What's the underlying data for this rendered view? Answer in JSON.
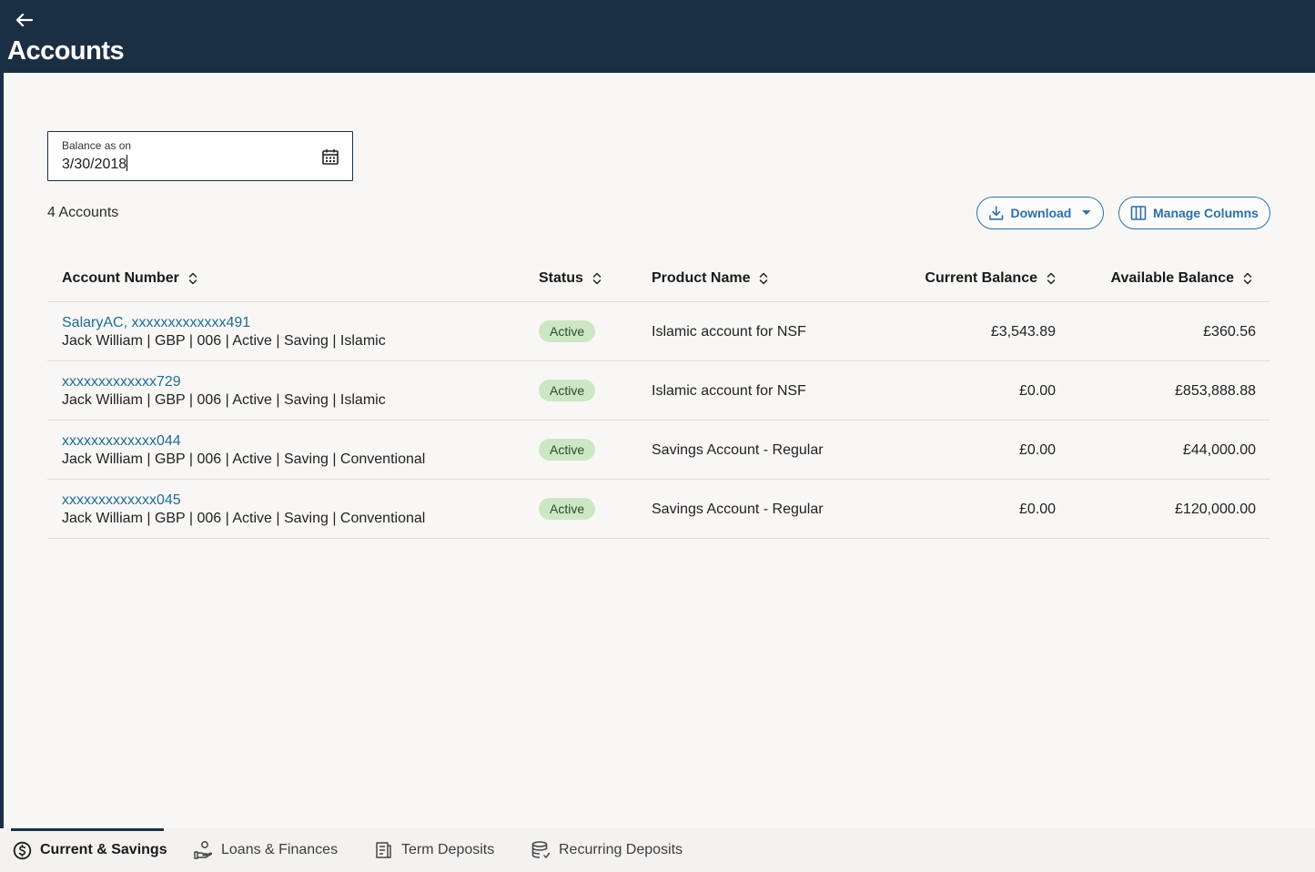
{
  "header": {
    "title": "Accounts",
    "back_icon": "arrow-left-icon"
  },
  "filter": {
    "label": "Balance as on",
    "value": "3/30/2018",
    "icon": "calendar-icon"
  },
  "summary": {
    "count_label": "4 Accounts"
  },
  "toolbar": {
    "download_label": "Download",
    "manage_columns_label": "Manage Columns"
  },
  "table": {
    "columns": [
      "Account Number",
      "Status",
      "Product Name",
      "Current Balance",
      "Available Balance"
    ],
    "rows": [
      {
        "account": "SalaryAC, xxxxxxxxxxxxx491",
        "details": "Jack William | GBP | 006 | Active | Saving | Islamic",
        "status": "Active",
        "product": "Islamic account for NSF",
        "current_balance": "£3,543.89",
        "available_balance": "£360.56"
      },
      {
        "account": "xxxxxxxxxxxxx729",
        "details": "Jack William | GBP | 006 | Active | Saving | Islamic",
        "status": "Active",
        "product": "Islamic account for NSF",
        "current_balance": "£0.00",
        "available_balance": "£853,888.88"
      },
      {
        "account": "xxxxxxxxxxxxx044",
        "details": "Jack William | GBP | 006 | Active | Saving | Conventional",
        "status": "Active",
        "product": "Savings Account - Regular",
        "current_balance": "£0.00",
        "available_balance": "£44,000.00"
      },
      {
        "account": "xxxxxxxxxxxxx045",
        "details": "Jack William | GBP | 006 | Active | Saving | Conventional",
        "status": "Active",
        "product": "Savings Account - Regular",
        "current_balance": "£0.00",
        "available_balance": "£120,000.00"
      }
    ]
  },
  "tabs": [
    {
      "label": "Current & Savings",
      "icon": "dollar-circle-icon",
      "active": true
    },
    {
      "label": "Loans & Finances",
      "icon": "loan-hand-icon",
      "active": false
    },
    {
      "label": "Term Deposits",
      "icon": "term-deposit-icon",
      "active": false
    },
    {
      "label": "Recurring Deposits",
      "icon": "recurring-deposit-icon",
      "active": false
    }
  ],
  "colors": {
    "header_bg": "#1b2f44",
    "link": "#1f6c94",
    "button": "#2f6fa5",
    "badge_bg": "#cde7c4"
  }
}
